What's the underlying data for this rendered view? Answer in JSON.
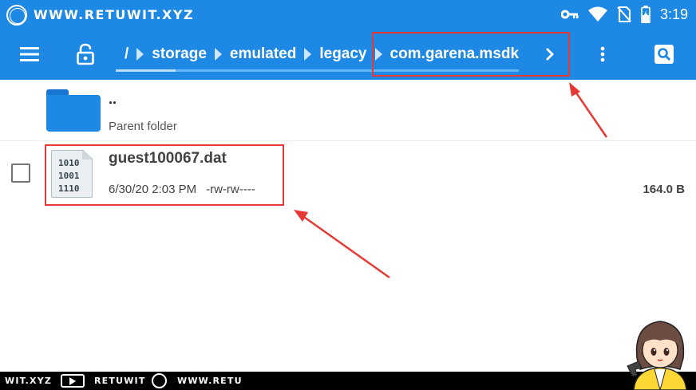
{
  "status_bar": {
    "watermark": "WWW.RETUWIT.XYZ",
    "time": "3:19",
    "icons": [
      "key-icon",
      "wifi-icon",
      "no-sim-icon",
      "battery-charging-icon"
    ]
  },
  "toolbar": {
    "icons": [
      "menu-icon",
      "lock-icon",
      "more-vert-icon",
      "search-icon"
    ],
    "breadcrumb": [
      {
        "label": "/"
      },
      {
        "label": "storage"
      },
      {
        "label": "emulated"
      },
      {
        "label": "legacy"
      },
      {
        "label": "com.garena.msdk"
      }
    ],
    "breadcrumb_more_icon": "chevron-right-icon"
  },
  "list": {
    "parent": {
      "name": "..",
      "label": "Parent folder",
      "icon": "folder-icon"
    },
    "files": [
      {
        "name": "guest100067.dat",
        "date": "6/30/20 2:03 PM",
        "permissions": "-rw-rw----",
        "size": "164.0 B",
        "icon": "binary-file-icon",
        "icon_text": "1010\n1001\n1110"
      }
    ]
  },
  "watermark_bar": {
    "items": [
      "WIT.XYZ",
      "RETUWIT",
      "WWW.RETU"
    ]
  },
  "colors": {
    "toolbar": "#1e88e5",
    "annotation": "#e53935",
    "folder": "#1e88e5"
  }
}
